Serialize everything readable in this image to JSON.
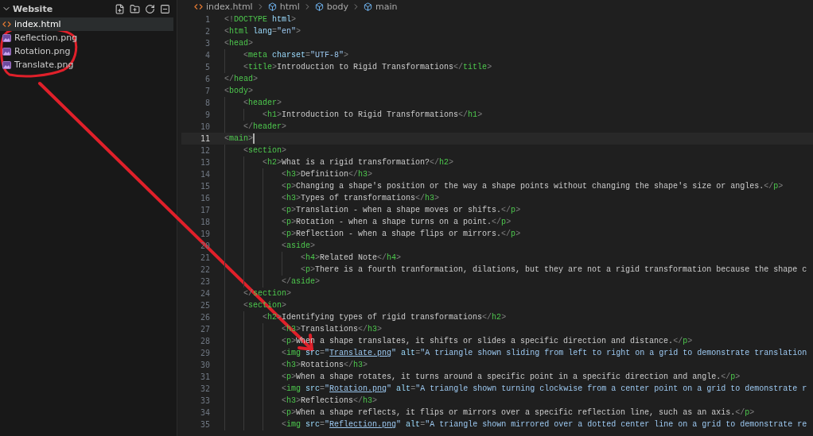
{
  "sidebar": {
    "title": "Website",
    "expanded": true,
    "files": [
      {
        "name": "index.html",
        "kind": "html",
        "selected": true
      },
      {
        "name": "Reflection.png",
        "kind": "image",
        "selected": false
      },
      {
        "name": "Rotation.png",
        "kind": "image",
        "selected": false
      },
      {
        "name": "Translate.png",
        "kind": "image",
        "selected": false
      }
    ]
  },
  "breadcrumbs": [
    {
      "label": "index.html",
      "kind": "file"
    },
    {
      "label": "html",
      "kind": "element"
    },
    {
      "label": "body",
      "kind": "element"
    },
    {
      "label": "main",
      "kind": "element"
    }
  ],
  "editor": {
    "lines": [
      {
        "number": "1",
        "current": false,
        "tokens": [
          {
            "kind": "punct",
            "text": "<!"
          },
          {
            "kind": "tag",
            "text": "DOCTYPE"
          },
          {
            "kind": "attr",
            "text": " html"
          },
          {
            "kind": "punct",
            "text": ">"
          }
        ]
      },
      {
        "number": "2",
        "current": false,
        "tokens": [
          {
            "kind": "punct",
            "text": "<"
          },
          {
            "kind": "tag",
            "text": "html"
          },
          {
            "kind": "attr",
            "text": " lang"
          },
          {
            "kind": "punct",
            "text": "="
          },
          {
            "kind": "string",
            "text": "\"en\""
          },
          {
            "kind": "punct",
            "text": ">"
          }
        ]
      },
      {
        "number": "3",
        "current": false,
        "tokens": [
          {
            "kind": "punct",
            "text": "<"
          },
          {
            "kind": "tag",
            "text": "head"
          },
          {
            "kind": "punct",
            "text": ">"
          }
        ]
      },
      {
        "number": "4",
        "current": false,
        "tokens": [
          {
            "kind": "guide"
          },
          {
            "kind": "punct",
            "text": "<"
          },
          {
            "kind": "tag",
            "text": "meta"
          },
          {
            "kind": "attr",
            "text": " charset"
          },
          {
            "kind": "punct",
            "text": "="
          },
          {
            "kind": "string",
            "text": "\"UTF-8\""
          },
          {
            "kind": "punct",
            "text": ">"
          }
        ]
      },
      {
        "number": "5",
        "current": false,
        "tokens": [
          {
            "kind": "guide"
          },
          {
            "kind": "punct",
            "text": "<"
          },
          {
            "kind": "tag",
            "text": "title"
          },
          {
            "kind": "punct",
            "text": ">"
          },
          {
            "kind": "text",
            "text": "Introduction to Rigid Transformations"
          },
          {
            "kind": "punct",
            "text": "</"
          },
          {
            "kind": "tag",
            "text": "title"
          },
          {
            "kind": "punct",
            "text": ">"
          }
        ]
      },
      {
        "number": "6",
        "current": false,
        "tokens": [
          {
            "kind": "punct",
            "text": "</"
          },
          {
            "kind": "tag",
            "text": "head"
          },
          {
            "kind": "punct",
            "text": ">"
          }
        ]
      },
      {
        "number": "7",
        "current": false,
        "tokens": [
          {
            "kind": "punct",
            "text": "<"
          },
          {
            "kind": "tag",
            "text": "body"
          },
          {
            "kind": "punct",
            "text": ">"
          }
        ]
      },
      {
        "number": "8",
        "current": false,
        "tokens": [
          {
            "kind": "guide"
          },
          {
            "kind": "punct",
            "text": "<"
          },
          {
            "kind": "tag",
            "text": "header"
          },
          {
            "kind": "punct",
            "text": ">"
          }
        ]
      },
      {
        "number": "9",
        "current": false,
        "tokens": [
          {
            "kind": "guide"
          },
          {
            "kind": "guide"
          },
          {
            "kind": "punct",
            "text": "<"
          },
          {
            "kind": "tag",
            "text": "h1"
          },
          {
            "kind": "punct",
            "text": ">"
          },
          {
            "kind": "text",
            "text": "Introduction to Rigid Transformations"
          },
          {
            "kind": "punct",
            "text": "</"
          },
          {
            "kind": "tag",
            "text": "h1"
          },
          {
            "kind": "punct",
            "text": ">"
          }
        ]
      },
      {
        "number": "10",
        "current": false,
        "tokens": [
          {
            "kind": "guide"
          },
          {
            "kind": "punct",
            "text": "</"
          },
          {
            "kind": "tag",
            "text": "header"
          },
          {
            "kind": "punct",
            "text": ">"
          }
        ]
      },
      {
        "number": "11",
        "current": true,
        "tokens": [
          {
            "kind": "punct",
            "text": "<"
          },
          {
            "kind": "tag",
            "text": "main"
          },
          {
            "kind": "punct",
            "text": ">"
          }
        ]
      },
      {
        "number": "12",
        "current": false,
        "tokens": [
          {
            "kind": "guide"
          },
          {
            "kind": "punct",
            "text": "<"
          },
          {
            "kind": "tag",
            "text": "section"
          },
          {
            "kind": "punct",
            "text": ">"
          }
        ]
      },
      {
        "number": "13",
        "current": false,
        "tokens": [
          {
            "kind": "guide"
          },
          {
            "kind": "guide"
          },
          {
            "kind": "punct",
            "text": "<"
          },
          {
            "kind": "tag",
            "text": "h2"
          },
          {
            "kind": "punct",
            "text": ">"
          },
          {
            "kind": "text",
            "text": "What is a rigid transformation?"
          },
          {
            "kind": "punct",
            "text": "</"
          },
          {
            "kind": "tag",
            "text": "h2"
          },
          {
            "kind": "punct",
            "text": ">"
          }
        ]
      },
      {
        "number": "14",
        "current": false,
        "tokens": [
          {
            "kind": "guide"
          },
          {
            "kind": "guide"
          },
          {
            "kind": "guide"
          },
          {
            "kind": "punct",
            "text": "<"
          },
          {
            "kind": "tag",
            "text": "h3"
          },
          {
            "kind": "punct",
            "text": ">"
          },
          {
            "kind": "text",
            "text": "Definition"
          },
          {
            "kind": "punct",
            "text": "</"
          },
          {
            "kind": "tag",
            "text": "h3"
          },
          {
            "kind": "punct",
            "text": ">"
          }
        ]
      },
      {
        "number": "15",
        "current": false,
        "tokens": [
          {
            "kind": "guide"
          },
          {
            "kind": "guide"
          },
          {
            "kind": "guide"
          },
          {
            "kind": "punct",
            "text": "<"
          },
          {
            "kind": "tag",
            "text": "p"
          },
          {
            "kind": "punct",
            "text": ">"
          },
          {
            "kind": "text",
            "text": "Changing a shape's position or the way a shape points without changing the shape's size or angles."
          },
          {
            "kind": "punct",
            "text": "</"
          },
          {
            "kind": "tag",
            "text": "p"
          },
          {
            "kind": "punct",
            "text": ">"
          }
        ]
      },
      {
        "number": "16",
        "current": false,
        "tokens": [
          {
            "kind": "guide"
          },
          {
            "kind": "guide"
          },
          {
            "kind": "guide"
          },
          {
            "kind": "punct",
            "text": "<"
          },
          {
            "kind": "tag",
            "text": "h3"
          },
          {
            "kind": "punct",
            "text": ">"
          },
          {
            "kind": "text",
            "text": "Types of transformations"
          },
          {
            "kind": "punct",
            "text": "</"
          },
          {
            "kind": "tag",
            "text": "h3"
          },
          {
            "kind": "punct",
            "text": ">"
          }
        ]
      },
      {
        "number": "17",
        "current": false,
        "tokens": [
          {
            "kind": "guide"
          },
          {
            "kind": "guide"
          },
          {
            "kind": "guide"
          },
          {
            "kind": "punct",
            "text": "<"
          },
          {
            "kind": "tag",
            "text": "p"
          },
          {
            "kind": "punct",
            "text": ">"
          },
          {
            "kind": "text",
            "text": "Translation - when a shape moves or shifts."
          },
          {
            "kind": "punct",
            "text": "</"
          },
          {
            "kind": "tag",
            "text": "p"
          },
          {
            "kind": "punct",
            "text": ">"
          }
        ]
      },
      {
        "number": "18",
        "current": false,
        "tokens": [
          {
            "kind": "guide"
          },
          {
            "kind": "guide"
          },
          {
            "kind": "guide"
          },
          {
            "kind": "punct",
            "text": "<"
          },
          {
            "kind": "tag",
            "text": "p"
          },
          {
            "kind": "punct",
            "text": ">"
          },
          {
            "kind": "text",
            "text": "Rotation - when a shape turns on a point."
          },
          {
            "kind": "punct",
            "text": "</"
          },
          {
            "kind": "tag",
            "text": "p"
          },
          {
            "kind": "punct",
            "text": ">"
          }
        ]
      },
      {
        "number": "19",
        "current": false,
        "tokens": [
          {
            "kind": "guide"
          },
          {
            "kind": "guide"
          },
          {
            "kind": "guide"
          },
          {
            "kind": "punct",
            "text": "<"
          },
          {
            "kind": "tag",
            "text": "p"
          },
          {
            "kind": "punct",
            "text": ">"
          },
          {
            "kind": "text",
            "text": "Reflection - when a shape flips or mirrors."
          },
          {
            "kind": "punct",
            "text": "</"
          },
          {
            "kind": "tag",
            "text": "p"
          },
          {
            "kind": "punct",
            "text": ">"
          }
        ]
      },
      {
        "number": "20",
        "current": false,
        "tokens": [
          {
            "kind": "guide"
          },
          {
            "kind": "guide"
          },
          {
            "kind": "guide"
          },
          {
            "kind": "punct",
            "text": "<"
          },
          {
            "kind": "tag",
            "text": "aside"
          },
          {
            "kind": "punct",
            "text": ">"
          }
        ]
      },
      {
        "number": "21",
        "current": false,
        "tokens": [
          {
            "kind": "guide"
          },
          {
            "kind": "guide"
          },
          {
            "kind": "guide"
          },
          {
            "kind": "guide"
          },
          {
            "kind": "punct",
            "text": "<"
          },
          {
            "kind": "tag",
            "text": "h4"
          },
          {
            "kind": "punct",
            "text": ">"
          },
          {
            "kind": "text",
            "text": "Related Note"
          },
          {
            "kind": "punct",
            "text": "</"
          },
          {
            "kind": "tag",
            "text": "h4"
          },
          {
            "kind": "punct",
            "text": ">"
          }
        ]
      },
      {
        "number": "22",
        "current": false,
        "tokens": [
          {
            "kind": "guide"
          },
          {
            "kind": "guide"
          },
          {
            "kind": "guide"
          },
          {
            "kind": "guide"
          },
          {
            "kind": "punct",
            "text": "<"
          },
          {
            "kind": "tag",
            "text": "p"
          },
          {
            "kind": "punct",
            "text": ">"
          },
          {
            "kind": "text",
            "text": "There is a fourth tranformation, dilations, but they are not a rigid transformation because the shape c"
          }
        ]
      },
      {
        "number": "23",
        "current": false,
        "tokens": [
          {
            "kind": "guide"
          },
          {
            "kind": "guide"
          },
          {
            "kind": "guide"
          },
          {
            "kind": "punct",
            "text": "</"
          },
          {
            "kind": "tag",
            "text": "aside"
          },
          {
            "kind": "punct",
            "text": ">"
          }
        ]
      },
      {
        "number": "24",
        "current": false,
        "tokens": [
          {
            "kind": "guide"
          },
          {
            "kind": "punct",
            "text": "</"
          },
          {
            "kind": "tag",
            "text": "section"
          },
          {
            "kind": "punct",
            "text": ">"
          }
        ]
      },
      {
        "number": "25",
        "current": false,
        "tokens": [
          {
            "kind": "guide"
          },
          {
            "kind": "punct",
            "text": "<"
          },
          {
            "kind": "tag",
            "text": "section"
          },
          {
            "kind": "punct",
            "text": ">"
          }
        ]
      },
      {
        "number": "26",
        "current": false,
        "tokens": [
          {
            "kind": "guide"
          },
          {
            "kind": "guide"
          },
          {
            "kind": "punct",
            "text": "<"
          },
          {
            "kind": "tag",
            "text": "h2"
          },
          {
            "kind": "punct",
            "text": ">"
          },
          {
            "kind": "text",
            "text": "Identifying types of rigid transformations"
          },
          {
            "kind": "punct",
            "text": "</"
          },
          {
            "kind": "tag",
            "text": "h2"
          },
          {
            "kind": "punct",
            "text": ">"
          }
        ]
      },
      {
        "number": "27",
        "current": false,
        "tokens": [
          {
            "kind": "guide"
          },
          {
            "kind": "guide"
          },
          {
            "kind": "guide"
          },
          {
            "kind": "punct",
            "text": "<"
          },
          {
            "kind": "tag",
            "text": "h3"
          },
          {
            "kind": "punct",
            "text": ">"
          },
          {
            "kind": "text",
            "text": "Translations"
          },
          {
            "kind": "punct",
            "text": "</"
          },
          {
            "kind": "tag",
            "text": "h3"
          },
          {
            "kind": "punct",
            "text": ">"
          }
        ]
      },
      {
        "number": "28",
        "current": false,
        "tokens": [
          {
            "kind": "guide"
          },
          {
            "kind": "guide"
          },
          {
            "kind": "guide"
          },
          {
            "kind": "punct",
            "text": "<"
          },
          {
            "kind": "tag",
            "text": "p"
          },
          {
            "kind": "punct",
            "text": ">"
          },
          {
            "kind": "text",
            "text": "When a shape translates, it shifts or slides a specific direction and distance."
          },
          {
            "kind": "punct",
            "text": "</"
          },
          {
            "kind": "tag",
            "text": "p"
          },
          {
            "kind": "punct",
            "text": ">"
          }
        ]
      },
      {
        "number": "29",
        "current": false,
        "tokens": [
          {
            "kind": "guide"
          },
          {
            "kind": "guide"
          },
          {
            "kind": "guide"
          },
          {
            "kind": "punct",
            "text": "<"
          },
          {
            "kind": "tag",
            "text": "img"
          },
          {
            "kind": "attr",
            "text": " src"
          },
          {
            "kind": "punct",
            "text": "="
          },
          {
            "kind": "string",
            "text": "\""
          },
          {
            "kind": "link",
            "text": "Translate.png"
          },
          {
            "kind": "string",
            "text": "\""
          },
          {
            "kind": "attr",
            "text": " alt"
          },
          {
            "kind": "punct",
            "text": "="
          },
          {
            "kind": "string",
            "text": "\"A triangle shown sliding from left to right on a grid to demonstrate translation"
          }
        ]
      },
      {
        "number": "30",
        "current": false,
        "tokens": [
          {
            "kind": "guide"
          },
          {
            "kind": "guide"
          },
          {
            "kind": "guide"
          },
          {
            "kind": "punct",
            "text": "<"
          },
          {
            "kind": "tag",
            "text": "h3"
          },
          {
            "kind": "punct",
            "text": ">"
          },
          {
            "kind": "text",
            "text": "Rotations"
          },
          {
            "kind": "punct",
            "text": "</"
          },
          {
            "kind": "tag",
            "text": "h3"
          },
          {
            "kind": "punct",
            "text": ">"
          }
        ]
      },
      {
        "number": "31",
        "current": false,
        "tokens": [
          {
            "kind": "guide"
          },
          {
            "kind": "guide"
          },
          {
            "kind": "guide"
          },
          {
            "kind": "punct",
            "text": "<"
          },
          {
            "kind": "tag",
            "text": "p"
          },
          {
            "kind": "punct",
            "text": ">"
          },
          {
            "kind": "text",
            "text": "When a shape rotates, it turns around a specific point in a specific direction and angle."
          },
          {
            "kind": "punct",
            "text": "</"
          },
          {
            "kind": "tag",
            "text": "p"
          },
          {
            "kind": "punct",
            "text": ">"
          }
        ]
      },
      {
        "number": "32",
        "current": false,
        "tokens": [
          {
            "kind": "guide"
          },
          {
            "kind": "guide"
          },
          {
            "kind": "guide"
          },
          {
            "kind": "punct",
            "text": "<"
          },
          {
            "kind": "tag",
            "text": "img"
          },
          {
            "kind": "attr",
            "text": " src"
          },
          {
            "kind": "punct",
            "text": "="
          },
          {
            "kind": "string",
            "text": "\""
          },
          {
            "kind": "link",
            "text": "Rotation.png"
          },
          {
            "kind": "string",
            "text": "\""
          },
          {
            "kind": "attr",
            "text": " alt"
          },
          {
            "kind": "punct",
            "text": "="
          },
          {
            "kind": "string",
            "text": "\"A triangle shown turning clockwise from a center point on a grid to demonstrate r"
          }
        ]
      },
      {
        "number": "33",
        "current": false,
        "tokens": [
          {
            "kind": "guide"
          },
          {
            "kind": "guide"
          },
          {
            "kind": "guide"
          },
          {
            "kind": "punct",
            "text": "<"
          },
          {
            "kind": "tag",
            "text": "h3"
          },
          {
            "kind": "punct",
            "text": ">"
          },
          {
            "kind": "text",
            "text": "Reflections"
          },
          {
            "kind": "punct",
            "text": "</"
          },
          {
            "kind": "tag",
            "text": "h3"
          },
          {
            "kind": "punct",
            "text": ">"
          }
        ]
      },
      {
        "number": "34",
        "current": false,
        "tokens": [
          {
            "kind": "guide"
          },
          {
            "kind": "guide"
          },
          {
            "kind": "guide"
          },
          {
            "kind": "punct",
            "text": "<"
          },
          {
            "kind": "tag",
            "text": "p"
          },
          {
            "kind": "punct",
            "text": ">"
          },
          {
            "kind": "text",
            "text": "When a shape reflects, it flips or mirrors over a specific reflection line, such as an axis."
          },
          {
            "kind": "punct",
            "text": "</"
          },
          {
            "kind": "tag",
            "text": "p"
          },
          {
            "kind": "punct",
            "text": ">"
          }
        ]
      },
      {
        "number": "35",
        "current": false,
        "tokens": [
          {
            "kind": "guide"
          },
          {
            "kind": "guide"
          },
          {
            "kind": "guide"
          },
          {
            "kind": "punct",
            "text": "<"
          },
          {
            "kind": "tag",
            "text": "img"
          },
          {
            "kind": "attr",
            "text": " src"
          },
          {
            "kind": "punct",
            "text": "="
          },
          {
            "kind": "string",
            "text": "\""
          },
          {
            "kind": "link",
            "text": "Reflection.png"
          },
          {
            "kind": "string",
            "text": "\""
          },
          {
            "kind": "attr",
            "text": " alt"
          },
          {
            "kind": "punct",
            "text": "="
          },
          {
            "kind": "string",
            "text": "\"A triangle shown mirrored over a dotted center line on a grid to demonstrate re"
          }
        ]
      }
    ]
  }
}
